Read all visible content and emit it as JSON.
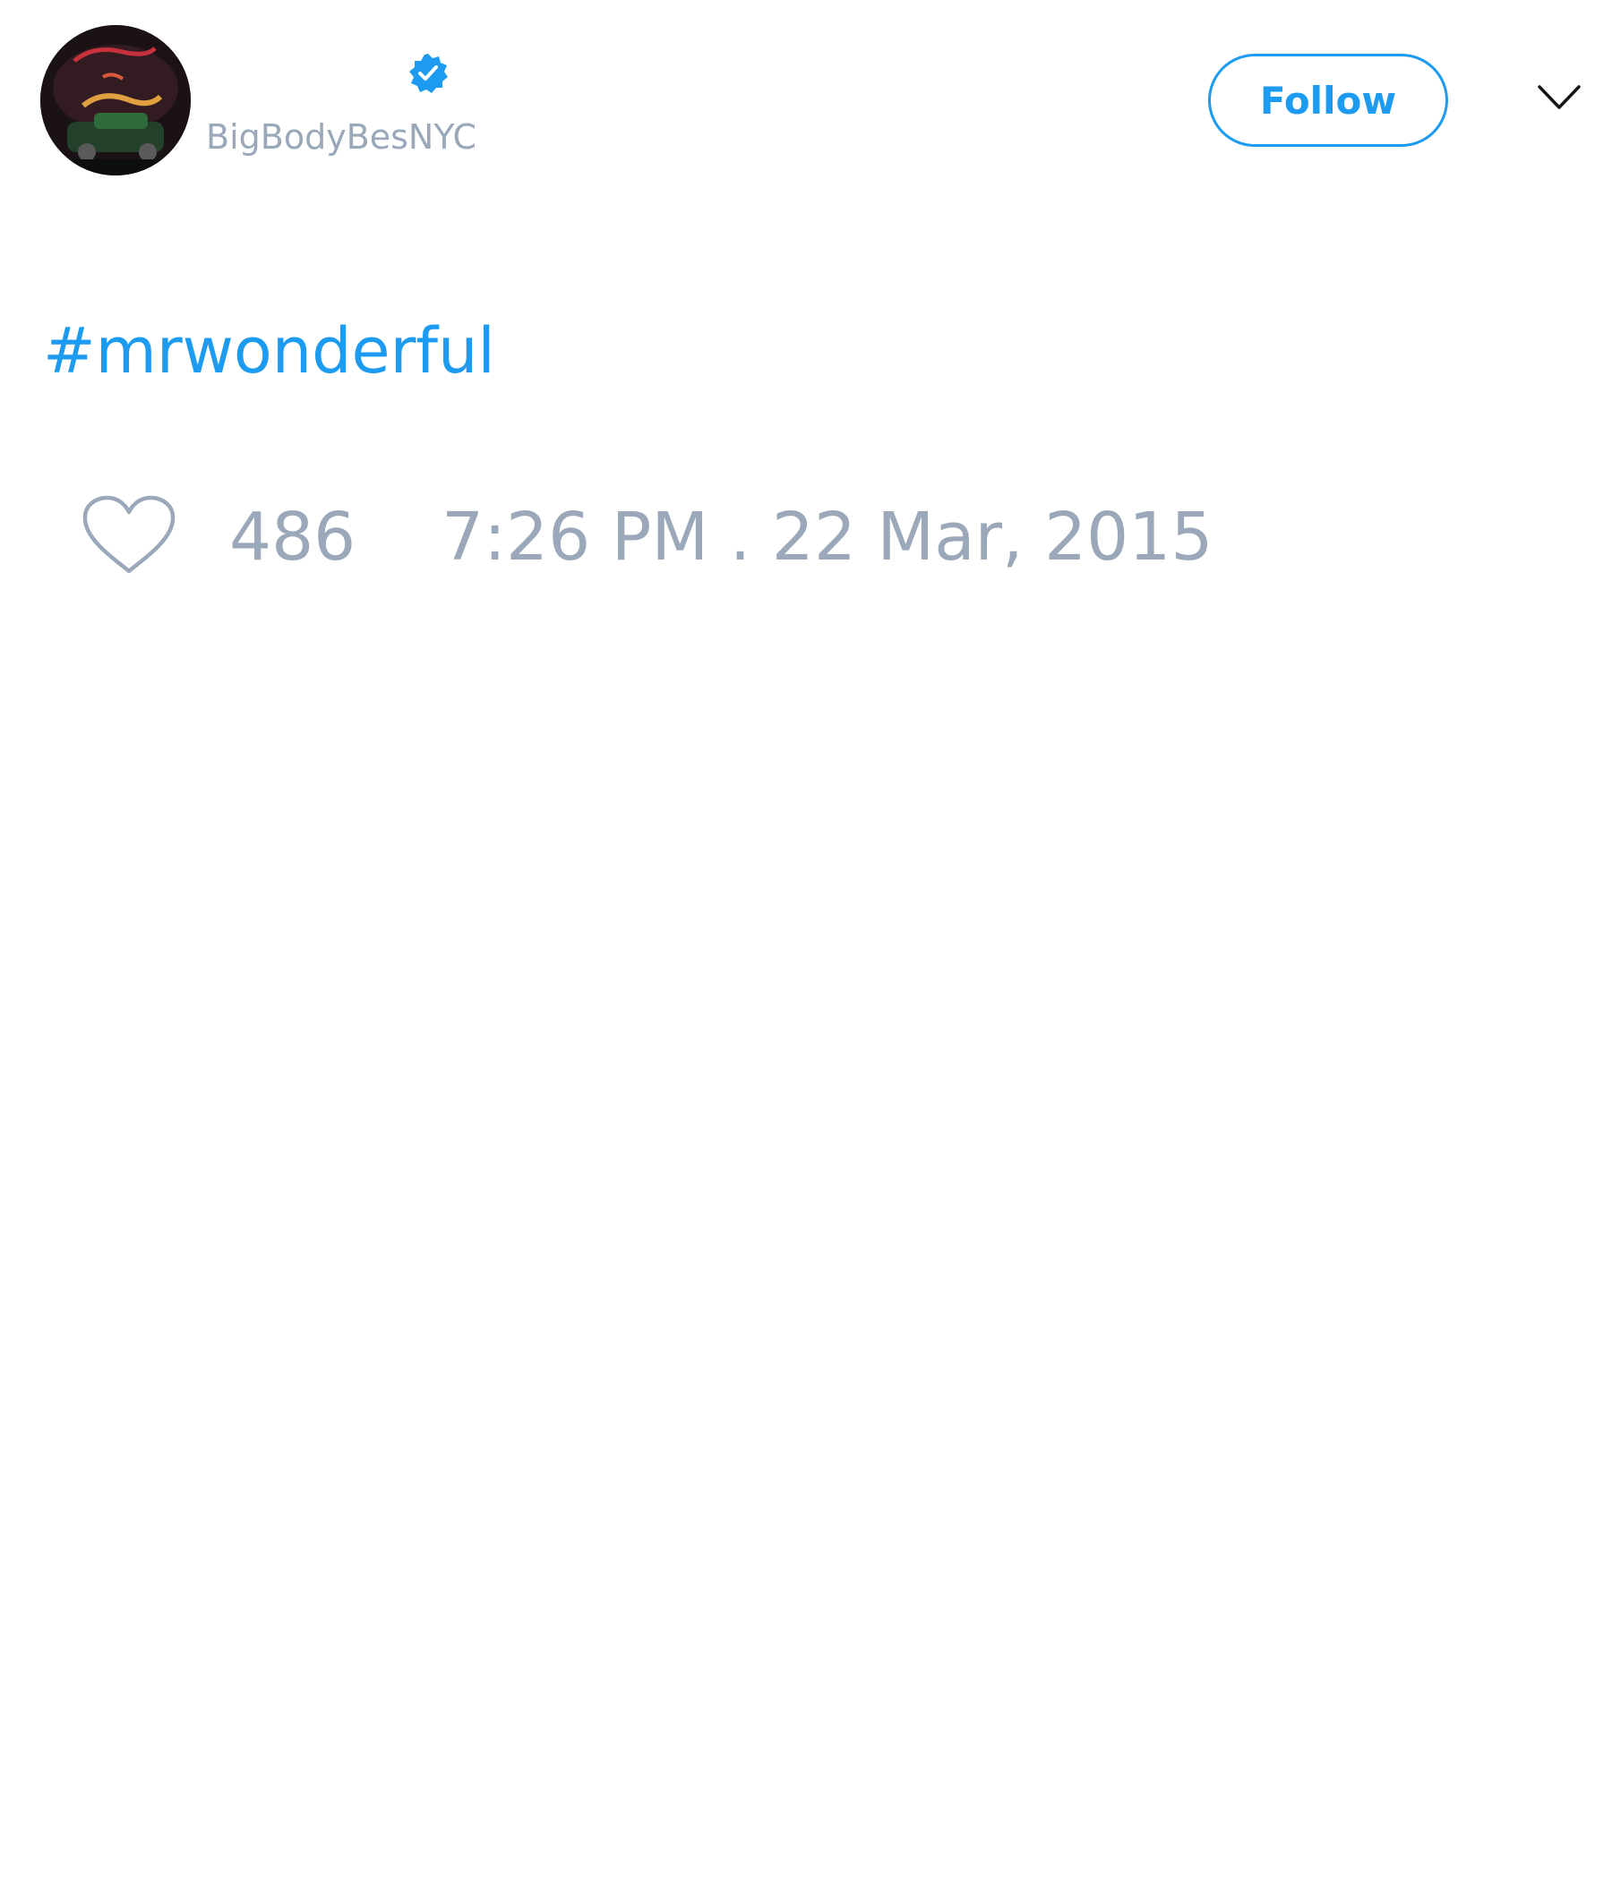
{
  "tweet": {
    "author": {
      "display_name": "",
      "handle": "BigBodyBesNYC",
      "verified": true,
      "avatar_icon": "profile-photo"
    },
    "follow_label": "Follow",
    "menu_icon": "chevron-down-icon",
    "text": "#mrwonderful",
    "likes": {
      "icon": "heart-icon",
      "count": "486"
    },
    "timestamp": "7:26 PM . 22 Mar, 2015"
  },
  "colors": {
    "accent": "#1d9bf0",
    "muted_text": "#9aa8ba",
    "background": "#ffffff"
  }
}
